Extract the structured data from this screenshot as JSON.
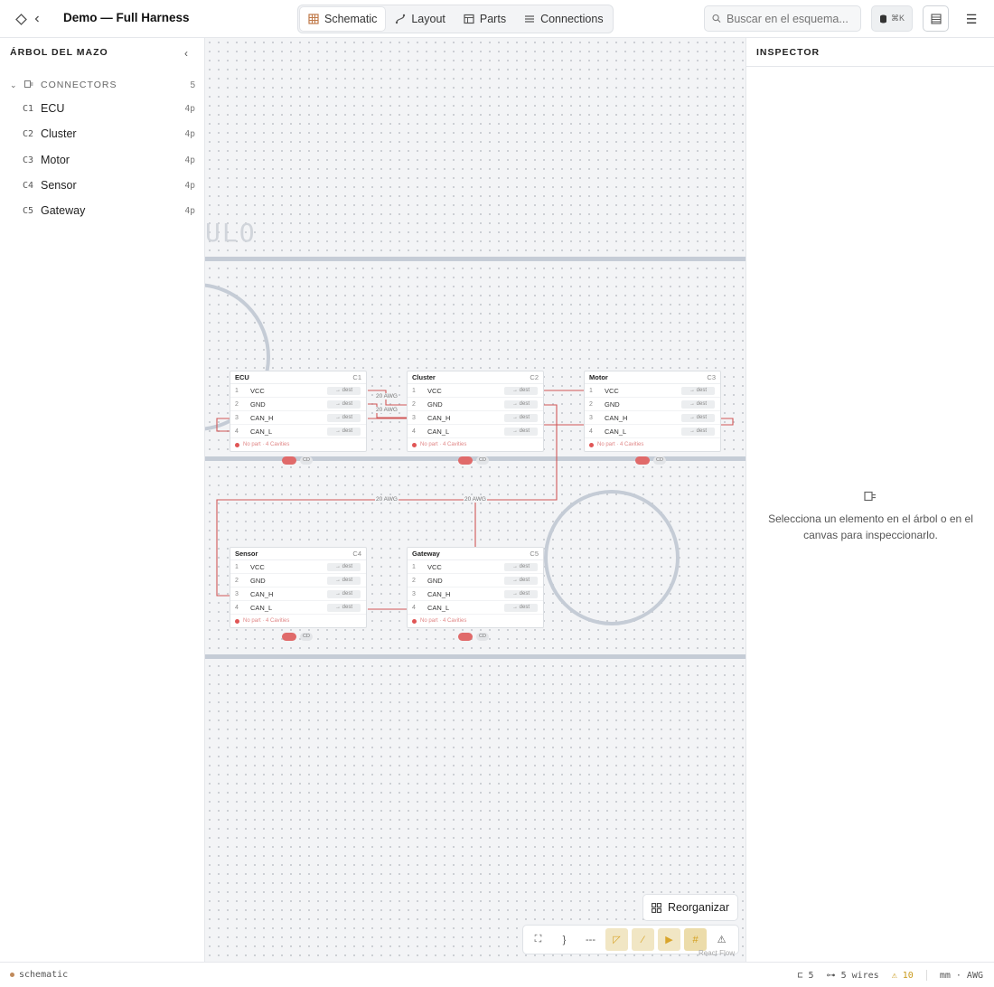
{
  "header": {
    "title": "Demo — Full Harness",
    "modes": [
      {
        "label": "Schematic",
        "icon": "grid-icon",
        "active": true
      },
      {
        "label": "Layout",
        "icon": "route-icon",
        "active": false
      },
      {
        "label": "Parts",
        "icon": "table-icon",
        "active": false
      },
      {
        "label": "Connections",
        "icon": "list-icon",
        "active": false
      }
    ],
    "search_placeholder": "Buscar en el esquema...",
    "shortcut": "⌘K"
  },
  "left_panel": {
    "title": "ÁRBOL DEL MAZO",
    "group": {
      "name": "CONNECTORS",
      "count": "5"
    },
    "items": [
      {
        "id": "C1",
        "name": "ECU",
        "pins": "4p"
      },
      {
        "id": "C2",
        "name": "Cluster",
        "pins": "4p"
      },
      {
        "id": "C3",
        "name": "Motor",
        "pins": "4p"
      },
      {
        "id": "C4",
        "name": "Sensor",
        "pins": "4p"
      },
      {
        "id": "C5",
        "name": "Gateway",
        "pins": "4p"
      }
    ]
  },
  "canvas": {
    "frame_title": "ULO",
    "connectors": [
      {
        "name": "ECU",
        "id": "C1"
      },
      {
        "name": "Cluster",
        "id": "C2"
      },
      {
        "name": "Motor",
        "id": "C3"
      },
      {
        "name": "Sensor",
        "id": "C4"
      },
      {
        "name": "Gateway",
        "id": "C5"
      }
    ],
    "pins": [
      {
        "num": "1",
        "name": "VCC"
      },
      {
        "num": "2",
        "name": "GND"
      },
      {
        "num": "3",
        "name": "CAN_H"
      },
      {
        "num": "4",
        "name": "CAN_L"
      }
    ],
    "pin_dest": "→ dest",
    "footer_text": "No part · 4 Cavities",
    "badge_label": "CD",
    "wire_label": "20 AWG",
    "reorganize_label": "Reorganizar",
    "watermark": "React Flow"
  },
  "inspector": {
    "title": "INSPECTOR",
    "empty_text": "Selecciona un elemento en el árbol o en el canvas para inspeccionarlo."
  },
  "status": {
    "mode": "schematic",
    "connectors": "5",
    "wires": "5 wires",
    "warnings": "10",
    "units": "mm · AWG"
  },
  "colors": {
    "wire": "#d05656",
    "bus": "#c5ccd6",
    "accent": "#e06a6a"
  }
}
